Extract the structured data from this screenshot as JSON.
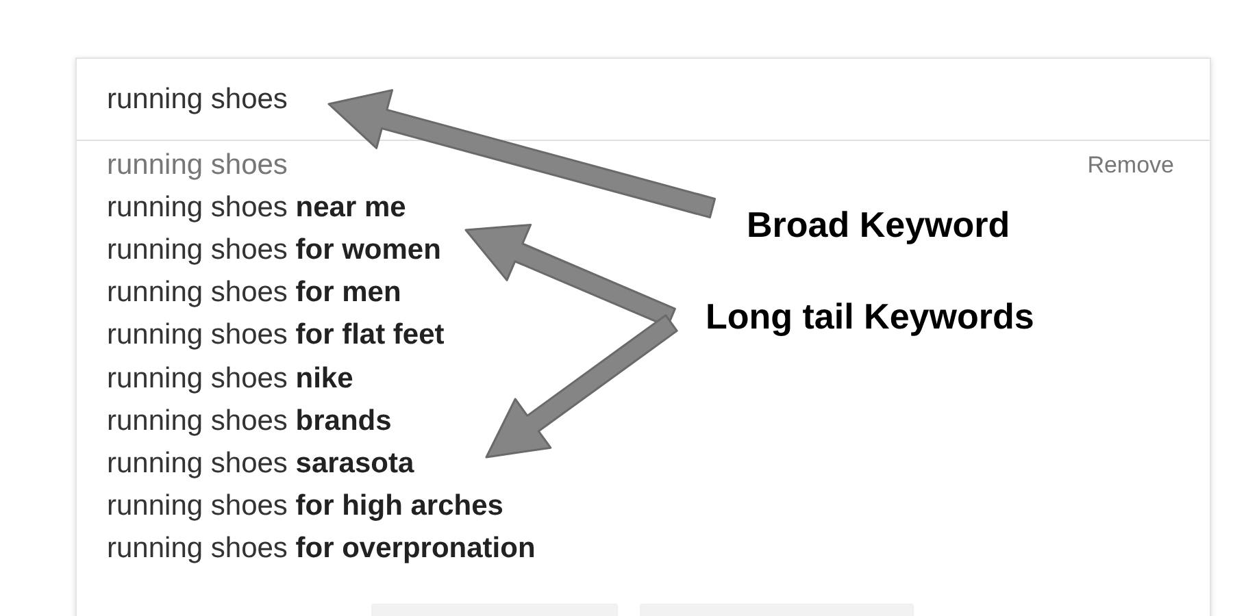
{
  "search": {
    "value": "running shoes"
  },
  "suggestions": [
    {
      "kind": "history",
      "text": "running shoes",
      "action": "Remove"
    },
    {
      "kind": "suggestion",
      "text": "running shoes **near me**"
    },
    {
      "kind": "suggestion",
      "text": "running shoes **for women**"
    },
    {
      "kind": "suggestion",
      "text": "running shoes **for men**"
    },
    {
      "kind": "suggestion",
      "text": "running shoes **for flat feet**"
    },
    {
      "kind": "suggestion",
      "text": "running shoes **nike**"
    },
    {
      "kind": "suggestion",
      "text": "running shoes **brands**"
    },
    {
      "kind": "suggestion",
      "text": "running shoes **sarasota**"
    },
    {
      "kind": "suggestion",
      "text": "running shoes **for high arches**"
    },
    {
      "kind": "suggestion",
      "text": "running shoes **for overpronation**"
    }
  ],
  "buttons": [
    {
      "kind": "blank"
    },
    {
      "kind": "blank"
    }
  ],
  "annotations": [
    {
      "label": "Broad Keyword"
    },
    {
      "label": "Long tail Keywords"
    }
  ]
}
